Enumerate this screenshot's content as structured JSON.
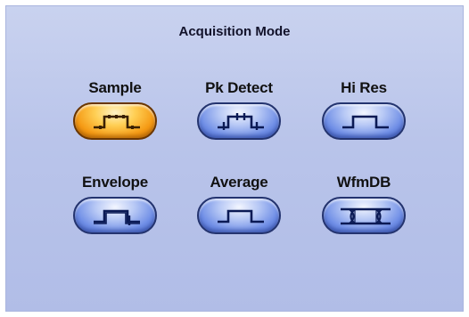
{
  "panel": {
    "title": "Acquisition Mode"
  },
  "modes": [
    {
      "label": "Sample",
      "icon": "sample-waveform-icon",
      "selected": true
    },
    {
      "label": "Pk Detect",
      "icon": "peak-detect-waveform-icon",
      "selected": false
    },
    {
      "label": "Hi Res",
      "icon": "hi-res-waveform-icon",
      "selected": false
    },
    {
      "label": "Envelope",
      "icon": "envelope-waveform-icon",
      "selected": false
    },
    {
      "label": "Average",
      "icon": "average-waveform-icon",
      "selected": false
    },
    {
      "label": "WfmDB",
      "icon": "wfmdb-waveform-icon",
      "selected": false
    }
  ],
  "colors": {
    "selected": "#f59a14",
    "unselected": "#6f8ee6",
    "icon_stroke": "#0b1a55"
  }
}
